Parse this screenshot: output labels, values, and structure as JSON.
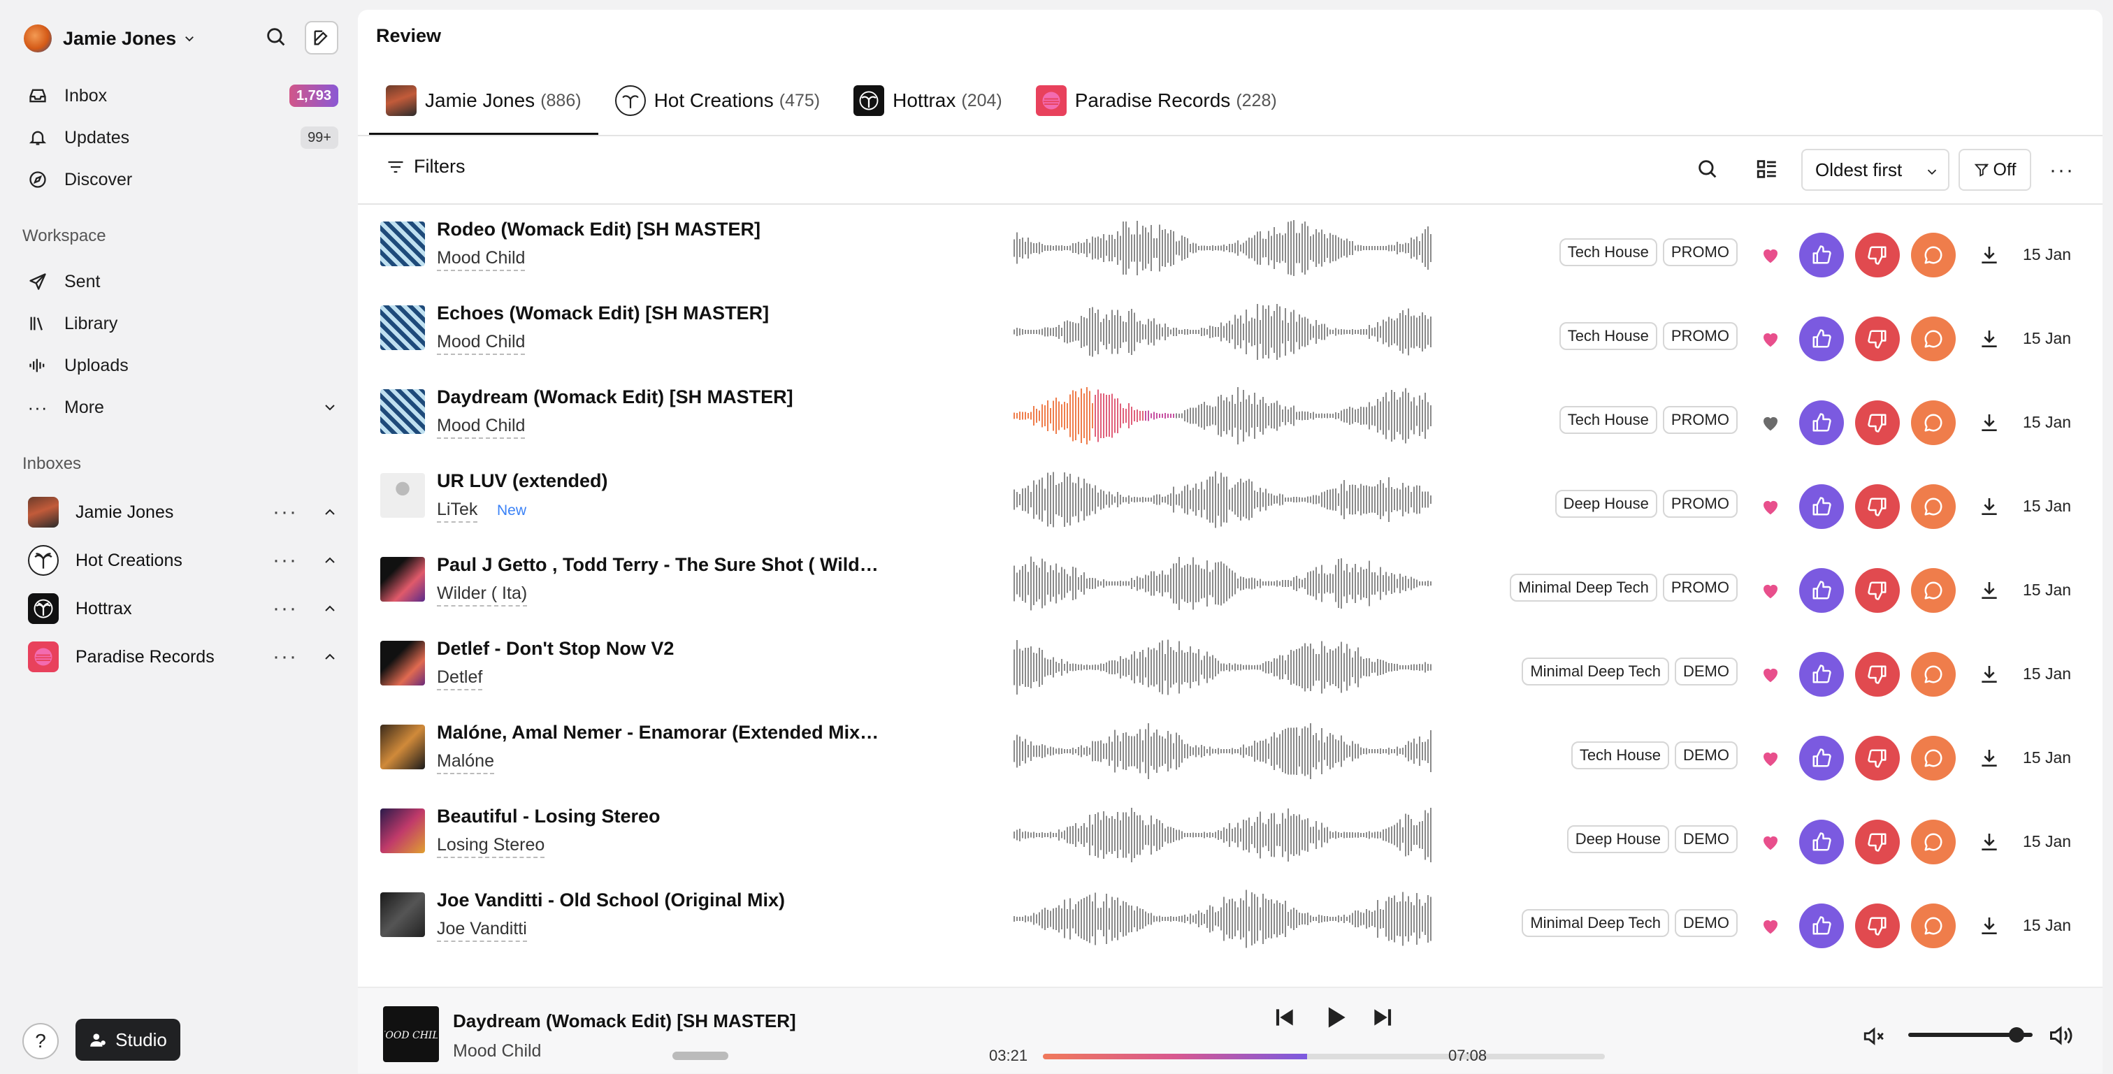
{
  "user": {
    "name": "Jamie Jones"
  },
  "nav": {
    "items": [
      {
        "label": "Inbox",
        "badge": "1,793",
        "icon": "inbox-icon"
      },
      {
        "label": "Updates",
        "badge": "99+",
        "icon": "bell-icon"
      },
      {
        "label": "Discover",
        "icon": "compass-icon"
      }
    ]
  },
  "workspace": {
    "label": "Workspace",
    "items": [
      {
        "label": "Sent",
        "icon": "send-icon"
      },
      {
        "label": "Library",
        "icon": "library-icon"
      },
      {
        "label": "Uploads",
        "icon": "waveform-icon"
      },
      {
        "label": "More",
        "icon": "more-icon"
      }
    ]
  },
  "inboxes": {
    "label": "Inboxes",
    "items": [
      {
        "label": "Jamie Jones"
      },
      {
        "label": "Hot Creations"
      },
      {
        "label": "Hottrax"
      },
      {
        "label": "Paradise Records"
      }
    ]
  },
  "footer": {
    "help": "?",
    "studio": "Studio"
  },
  "review": {
    "title": "Review",
    "tabs": [
      {
        "label": "Jamie Jones",
        "count": "(886)"
      },
      {
        "label": "Hot Creations",
        "count": "(475)"
      },
      {
        "label": "Hottrax",
        "count": "(204)"
      },
      {
        "label": "Paradise Records",
        "count": "(228)"
      }
    ]
  },
  "toolbar": {
    "filters": "Filters",
    "sort": "Oldest first",
    "filter_toggle": "Off"
  },
  "tracks": [
    {
      "title": "Rodeo (Womack Edit) [SH MASTER]",
      "artist": "Mood Child",
      "new": "",
      "tags": [
        "Tech House",
        "PROMO"
      ],
      "liked": true,
      "date": "15 Jan"
    },
    {
      "title": "Echoes (Womack Edit) [SH MASTER]",
      "artist": "Mood Child",
      "new": "",
      "tags": [
        "Tech House",
        "PROMO"
      ],
      "liked": true,
      "date": "15 Jan"
    },
    {
      "title": "Daydream (Womack Edit) [SH MASTER]",
      "artist": "Mood Child",
      "new": "",
      "tags": [
        "Tech House",
        "PROMO"
      ],
      "liked": false,
      "date": "15 Jan"
    },
    {
      "title": "UR LUV (extended)",
      "artist": "LiTek",
      "new": "New",
      "tags": [
        "Deep House",
        "PROMO"
      ],
      "liked": true,
      "date": "15 Jan"
    },
    {
      "title": "Paul J Getto , Todd Terry - The Sure Shot ( Wilder IT...",
      "artist": "Wilder ( Ita)",
      "new": "",
      "tags": [
        "Minimal Deep Tech",
        "PROMO"
      ],
      "liked": true,
      "date": "15 Jan"
    },
    {
      "title": "Detlef - Don't Stop Now V2",
      "artist": "Detlef",
      "new": "",
      "tags": [
        "Minimal Deep Tech",
        "DEMO"
      ],
      "liked": true,
      "date": "15 Jan"
    },
    {
      "title": "Malóne, Amal Nemer - Enamorar (Extended Mix) ...",
      "artist": "Malóne",
      "new": "",
      "tags": [
        "Tech House",
        "DEMO"
      ],
      "liked": true,
      "date": "15 Jan"
    },
    {
      "title": "Beautiful - Losing Stereo",
      "artist": "Losing Stereo",
      "new": "",
      "tags": [
        "Deep House",
        "DEMO"
      ],
      "liked": true,
      "date": "15 Jan"
    },
    {
      "title": "Joe Vanditti - Old School (Original Mix)",
      "artist": "Joe Vanditti",
      "new": "",
      "tags": [
        "Minimal Deep Tech",
        "DEMO"
      ],
      "liked": true,
      "date": "15 Jan"
    }
  ],
  "player": {
    "title": "Daydream (Womack Edit) [SH MASTER]",
    "artist": "Mood Child",
    "art_text": "MOOD CHILD",
    "elapsed": "03:21",
    "duration": "07:08",
    "progress": 0.47,
    "volume": 0.92
  },
  "colors": {
    "like": "#7b5ae0",
    "dislike": "#e14a4f",
    "comment": "#ef7d4b",
    "heart_on": "#e84f8c",
    "heart_off": "#6b6b6b"
  }
}
